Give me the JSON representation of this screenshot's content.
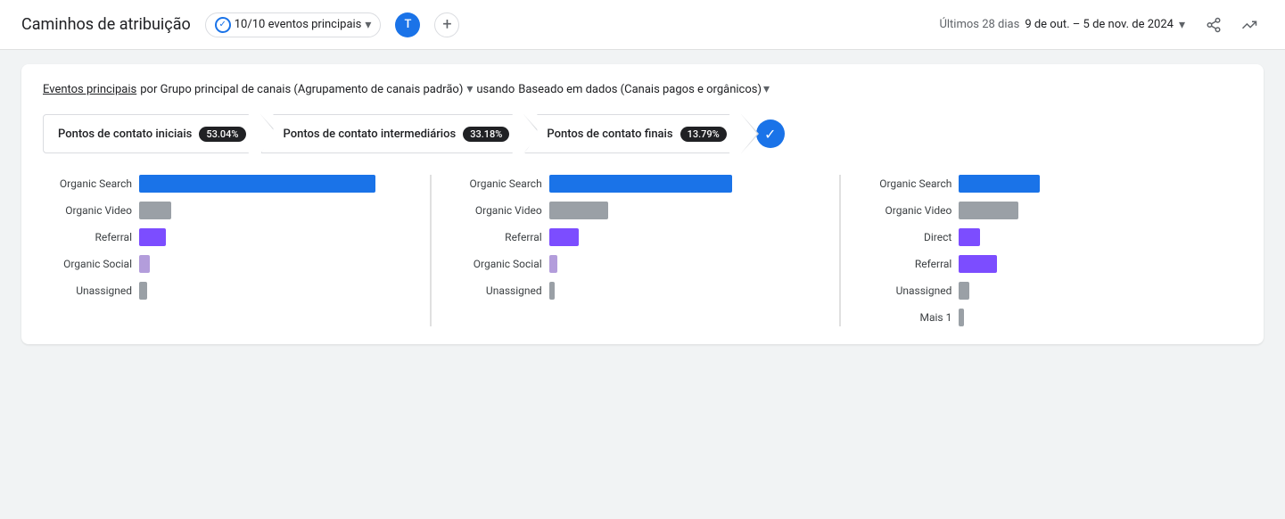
{
  "header": {
    "title": "Caminhos de atribuição",
    "filter_label": "10/10 eventos principais",
    "avatar_initial": "T",
    "date_label": "Últimos 28 dias",
    "date_range": "9 de out. – 5 de nov. de 2024",
    "chevron": "▾"
  },
  "subtitle": {
    "prefix": "Eventos principais",
    "middle": " por Grupo principal de canais (Agrupamento de canais padrão)",
    "connector": "usando",
    "end": "Baseado em dados (Canais pagos e orgânicos)"
  },
  "funnel": {
    "steps": [
      {
        "label": "Pontos de contato iniciais",
        "badge": "53.04%"
      },
      {
        "label": "Pontos de contato intermediários",
        "badge": "33.18%"
      },
      {
        "label": "Pontos de contato finais",
        "badge": "13.79%"
      }
    ]
  },
  "charts": [
    {
      "title": "Pontos de contato iniciais",
      "bars": [
        {
          "label": "Organic Search",
          "color": "blue",
          "width_pct": 88
        },
        {
          "label": "Organic Video",
          "color": "gray",
          "width_pct": 12
        },
        {
          "label": "Referral",
          "color": "purple",
          "width_pct": 10
        },
        {
          "label": "Organic Social",
          "color": "light-purple",
          "width_pct": 4
        },
        {
          "label": "Unassigned",
          "color": "gray",
          "width_pct": 3
        }
      ]
    },
    {
      "title": "Pontos de contato intermediários",
      "bars": [
        {
          "label": "Organic Search",
          "color": "blue",
          "width_pct": 68
        },
        {
          "label": "Organic Video",
          "color": "gray",
          "width_pct": 22
        },
        {
          "label": "Referral",
          "color": "purple",
          "width_pct": 11
        },
        {
          "label": "Organic Social",
          "color": "light-purple",
          "width_pct": 3
        },
        {
          "label": "Unassigned",
          "color": "gray",
          "width_pct": 2
        }
      ]
    },
    {
      "title": "Pontos de contato finais",
      "bars": [
        {
          "label": "Organic Search",
          "color": "blue",
          "width_pct": 30
        },
        {
          "label": "Organic Video",
          "color": "gray",
          "width_pct": 22
        },
        {
          "label": "Direct",
          "color": "purple-small",
          "width_pct": 8
        },
        {
          "label": "Referral",
          "color": "purple",
          "width_pct": 14
        },
        {
          "label": "Unassigned",
          "color": "gray",
          "width_pct": 4
        },
        {
          "label": "Mais 1",
          "color": "gray",
          "width_pct": 2
        }
      ]
    }
  ]
}
